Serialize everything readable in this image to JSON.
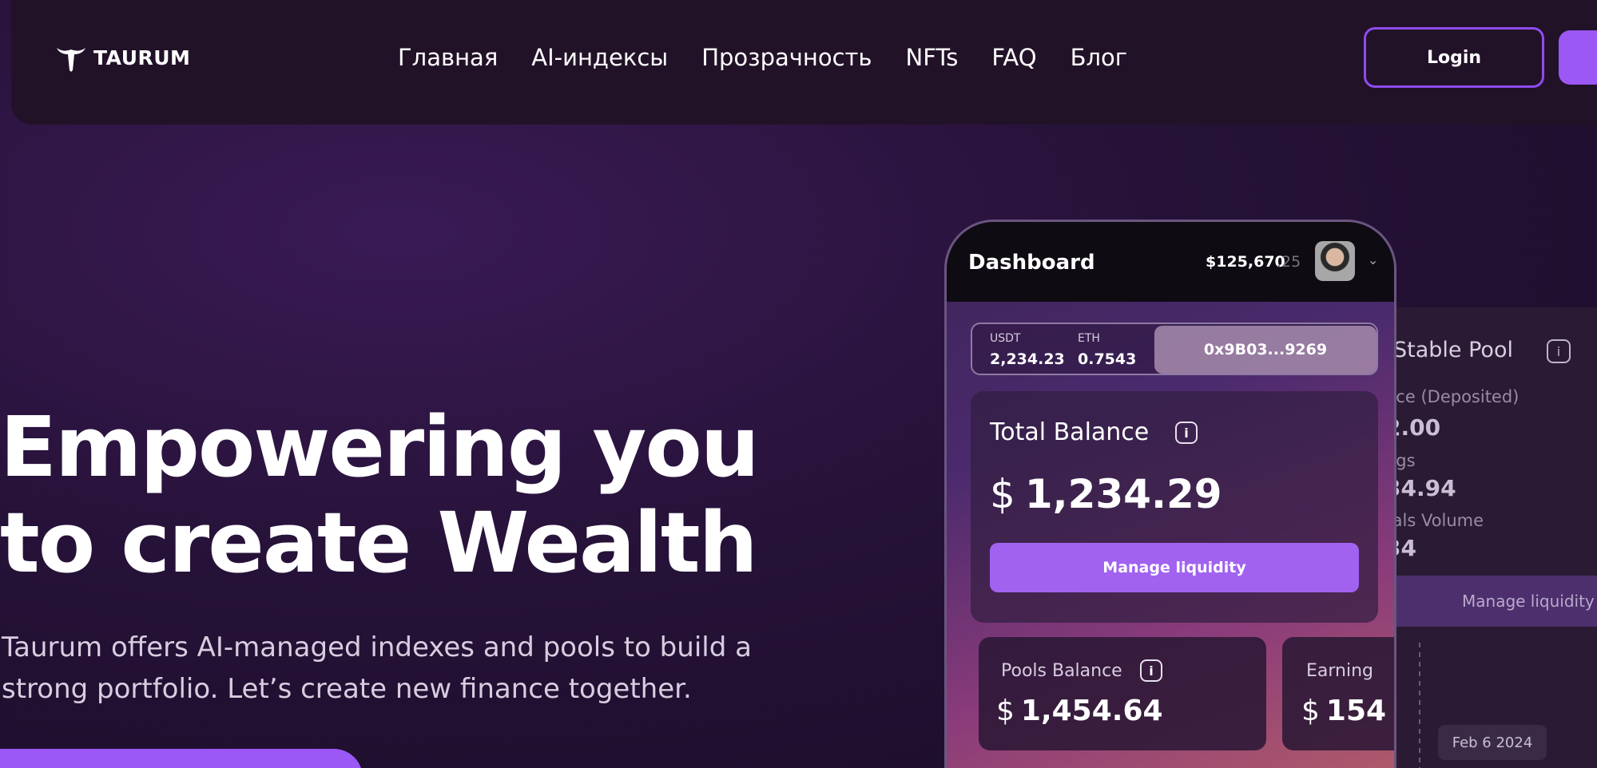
{
  "navbar": {
    "brand": "TAURUM",
    "links": [
      "Главная",
      "AI-индексы",
      "Прозрачность",
      "NFTs",
      "FAQ",
      "Блог"
    ],
    "login_label": "Login"
  },
  "hero": {
    "title_line1": "Empowering you",
    "title_line2": "to create Wealth",
    "subtitle_line1": "Taurum offers AI-managed indexes and pools to build a",
    "subtitle_line2": "strong portfolio. Let’s create new finance together."
  },
  "phone": {
    "title": "Dashboard",
    "balance": "$125,670",
    "balance_decimal": ".25",
    "wallet": {
      "usdt_label": "USDT",
      "usdt_value": "2,234.23",
      "eth_label": "ETH",
      "eth_value": "0.7543",
      "address": "0x9B03...9269"
    },
    "total_balance": {
      "label": "Total Balance",
      "currency": "$",
      "value": "1,234.29",
      "button_label": "Manage liquidity"
    },
    "pools_balance": {
      "label": "Pools Balance",
      "currency": "$",
      "value": "1,454.64"
    },
    "earnings": {
      "label": "Earning",
      "currency": "$",
      "value": "154"
    },
    "info_glyph": "i"
  },
  "back_card": {
    "title": "Stable Pool",
    "label1": "nce (Deposited)",
    "value1": "2.00",
    "label2": "ngs",
    "value2": "34.94",
    "label3": "rals Volume",
    "value3": "34",
    "button_label": "Manage liquidity",
    "date": "Feb 6 2024"
  },
  "colors": {
    "accent": "#9b58f5",
    "login_border": "#8e4cf0",
    "navbar_bg": "#221228"
  }
}
